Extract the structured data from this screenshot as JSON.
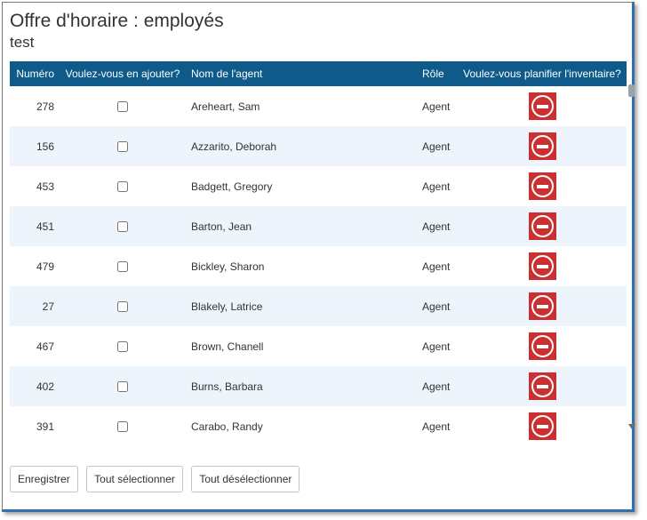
{
  "dialog": {
    "title": "Offre d'horaire : employés",
    "subtitle": "test"
  },
  "table": {
    "headers": {
      "number": "Numéro",
      "add": "Voulez-vous en ajouter?",
      "name": "Nom de l'agent",
      "role": "Rôle",
      "inventory": "Voulez-vous planifier l'inventaire?"
    },
    "rows": [
      {
        "number": "278",
        "name": "Areheart, Sam",
        "role": "Agent",
        "checked": false
      },
      {
        "number": "156",
        "name": "Azzarito, Deborah",
        "role": "Agent",
        "checked": false
      },
      {
        "number": "453",
        "name": "Badgett, Gregory",
        "role": "Agent",
        "checked": false
      },
      {
        "number": "451",
        "name": "Barton, Jean",
        "role": "Agent",
        "checked": false
      },
      {
        "number": "479",
        "name": "Bickley, Sharon",
        "role": "Agent",
        "checked": false
      },
      {
        "number": "27",
        "name": "Blakely, Latrice",
        "role": "Agent",
        "checked": false
      },
      {
        "number": "467",
        "name": "Brown, Chanell",
        "role": "Agent",
        "checked": false
      },
      {
        "number": "402",
        "name": "Burns, Barbara",
        "role": "Agent",
        "checked": false
      },
      {
        "number": "391",
        "name": "Carabo, Randy",
        "role": "Agent",
        "checked": false
      }
    ],
    "inventory_icon": "no-entry-icon"
  },
  "buttons": {
    "save": "Enregistrer",
    "select_all": "Tout sélectionner",
    "deselect_all": "Tout désélectionner"
  },
  "colors": {
    "header_bg": "#0e5a8a",
    "row_alt_bg": "#edf4fb",
    "no_entry_red": "#cc2f2f",
    "dialog_border_accent": "#2f6fb2"
  }
}
